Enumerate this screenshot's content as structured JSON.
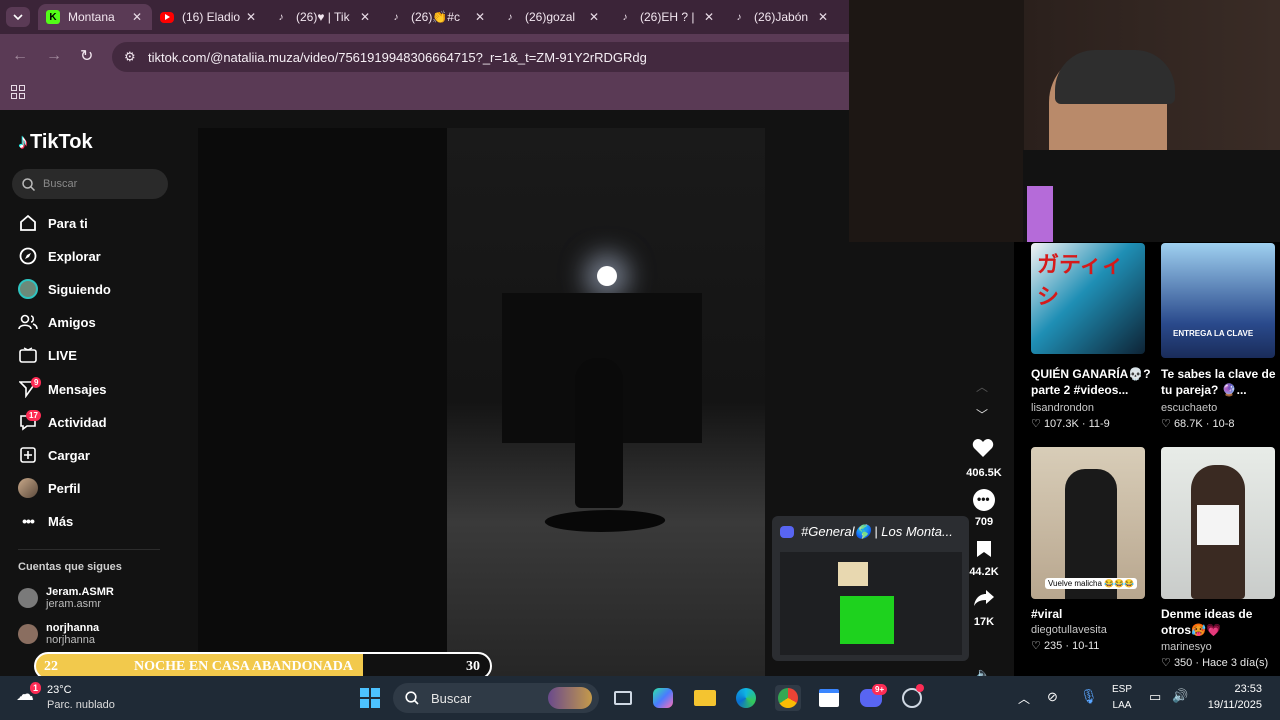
{
  "browser": {
    "tabs": [
      {
        "title": "Montana",
        "favicon": "K"
      },
      {
        "title": "(16) Eladio",
        "favicon": "yt"
      },
      {
        "title": "(26)♥ | Tik",
        "favicon": "tt"
      },
      {
        "title": "(26)👏#c",
        "favicon": "tt"
      },
      {
        "title": "(26)gozal",
        "favicon": "tt"
      },
      {
        "title": "(26)EH ? |",
        "favicon": "tt"
      },
      {
        "title": "(26)Jabón",
        "favicon": "tt"
      }
    ],
    "url": "tiktok.com/@nataliia.muza/video/7561919948306664715?_r=1&_t=ZM-91Y2rRDGRdg"
  },
  "tiktok": {
    "logo": "TikTok",
    "search_placeholder": "Buscar",
    "nav": [
      {
        "label": "Para ti",
        "icon": "home-icon"
      },
      {
        "label": "Explorar",
        "icon": "compass-icon"
      },
      {
        "label": "Siguiendo",
        "icon": "following-avatar-icon"
      },
      {
        "label": "Amigos",
        "icon": "friends-icon"
      },
      {
        "label": "LIVE",
        "icon": "live-icon"
      },
      {
        "label": "Mensajes",
        "icon": "messages-icon",
        "badge": "9"
      },
      {
        "label": "Actividad",
        "icon": "activity-icon",
        "badge": "17"
      },
      {
        "label": "Cargar",
        "icon": "upload-icon"
      },
      {
        "label": "Perfil",
        "icon": "profile-avatar-icon"
      },
      {
        "label": "Más",
        "icon": "more-icon"
      }
    ],
    "following_header": "Cuentas que sigues",
    "following": [
      {
        "name": "Jeram.ASMR",
        "handle": "jeram.asmr"
      },
      {
        "name": "norjhanna",
        "handle": "norjhanna"
      }
    ],
    "actions": {
      "likes": "406.5K",
      "comments": "709",
      "saves": "44.2K",
      "shares": "17K"
    },
    "recommended": [
      {
        "caption": "QUIÉN GANARÍA💀? parte 2 #videos...",
        "author": "lisandrondon",
        "likes": "107.3K",
        "date": "11-9",
        "thumb_text": "ガティィシ"
      },
      {
        "caption": "Te sabes la clave de tu pareja? 🔮...",
        "author": "escuchaeto",
        "likes": "68.7K",
        "date": "10-8",
        "thumb_text": "ENTREGA LA CLAVE"
      },
      {
        "caption": "#viral",
        "author": "diegotullavesita",
        "likes": "235",
        "date": "10-11",
        "thumb_text": "Vuelve malicha 😂😂😂"
      },
      {
        "caption": "Denme ideas de otros🥵💗",
        "author": "marinesyo",
        "likes": "350",
        "date": "Hace 3 día(s)",
        "thumb_text": ""
      }
    ]
  },
  "discord_popup": {
    "title": "#General🌎 | Los Monta..."
  },
  "stream_overlay": {
    "left_number": "22",
    "text": "NOCHE EN CASA ABANDONADA",
    "right_number": "30"
  },
  "taskbar": {
    "weather_temp": "23°C",
    "weather_desc": "Parc. nublado",
    "weather_badge": "1",
    "search_label": "Buscar",
    "discord_badge": "9+",
    "lang_top": "ESP",
    "lang_bottom": "LAA",
    "time": "23:53",
    "date": "19/11/2025"
  },
  "colors": {
    "tiktok_red": "#fe2c55",
    "chrome_tab": "#3b2438",
    "chrome_toolbar": "#5a3a55",
    "taskbar": "#1f2a36",
    "overlay_yellow": "#f2c94c"
  }
}
